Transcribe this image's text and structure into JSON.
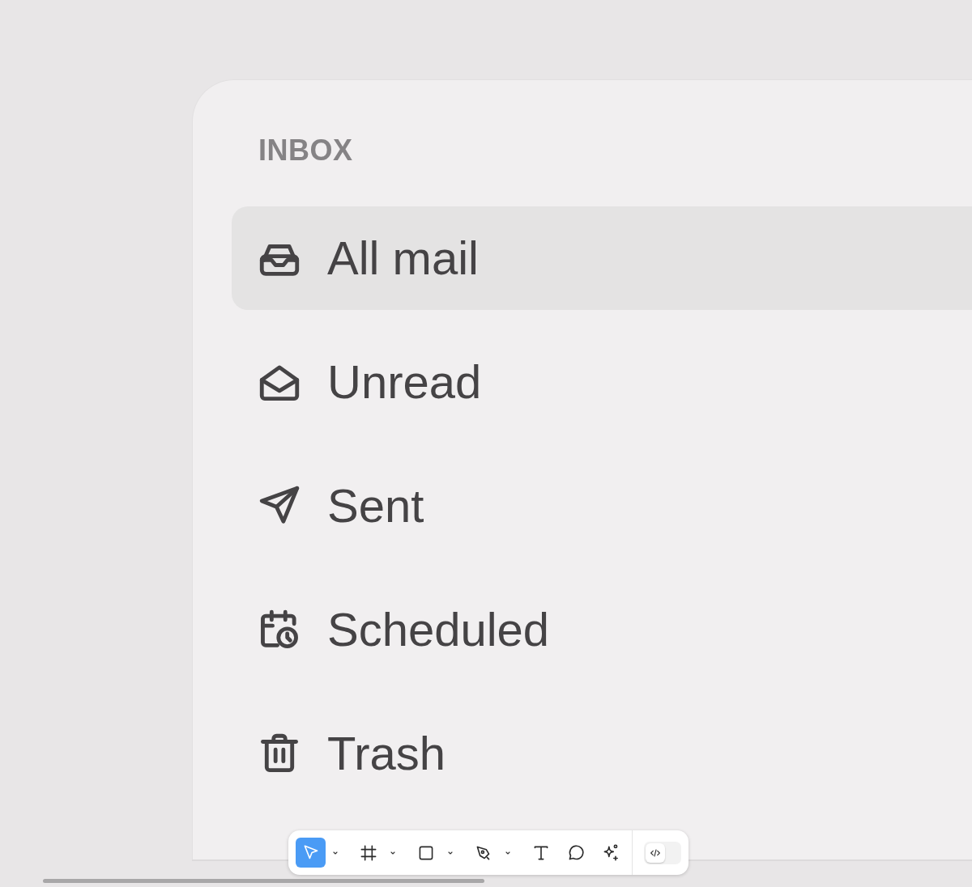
{
  "sidebar": {
    "heading": "INBOX",
    "items": [
      {
        "label": "All mail",
        "kind": "inbox",
        "selected": true
      },
      {
        "label": "Unread",
        "kind": "envelope",
        "selected": false
      },
      {
        "label": "Sent",
        "kind": "send",
        "selected": false
      },
      {
        "label": "Scheduled",
        "kind": "calendar-clock",
        "selected": false
      },
      {
        "label": "Trash",
        "kind": "trash",
        "selected": false
      }
    ]
  },
  "toolbar": {
    "tools": [
      {
        "kind": "move",
        "selected": true,
        "caret": true
      },
      {
        "kind": "frame",
        "selected": false,
        "caret": true
      },
      {
        "kind": "rectangle",
        "selected": false,
        "caret": true
      },
      {
        "kind": "pen",
        "selected": false,
        "caret": true
      },
      {
        "kind": "text",
        "selected": false,
        "caret": false
      },
      {
        "kind": "comment",
        "selected": false,
        "caret": false
      },
      {
        "kind": "ai",
        "selected": false,
        "caret": false
      }
    ],
    "dev_mode": {
      "on": false
    }
  }
}
